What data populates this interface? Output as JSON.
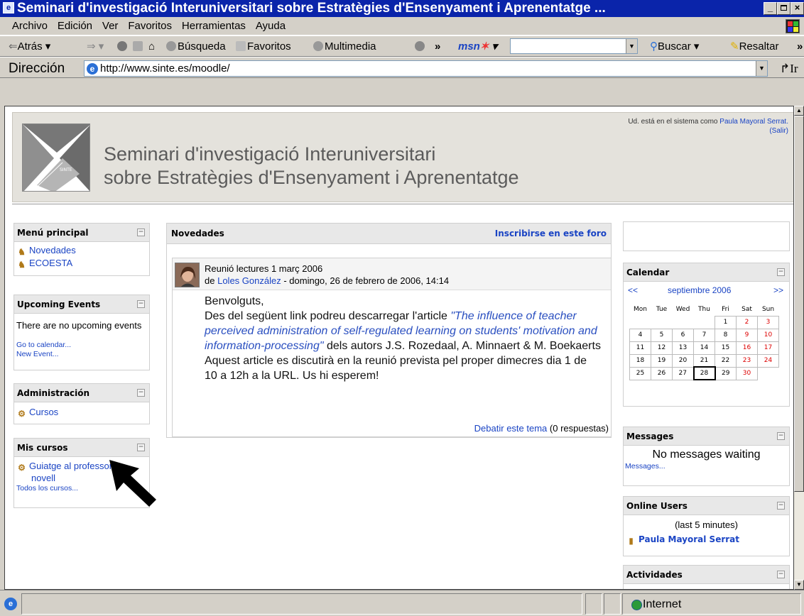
{
  "window": {
    "title": "Seminari d'investigació Interuniversitari sobre Estratègies d'Ensenyament i Aprenentatge ...",
    "minimize": "_",
    "maximize": "▫",
    "close": "×"
  },
  "menubar": {
    "items": [
      "Archivo",
      "Edición",
      "Ver",
      "Favoritos",
      "Herramientas",
      "Ayuda"
    ]
  },
  "toolbar": {
    "back": "Atrás",
    "search": "Búsqueda",
    "favorites": "Favoritos",
    "media": "Multimedia",
    "more": "»",
    "msn": "msn",
    "buscar": "Buscar",
    "resaltar": "Resaltar"
  },
  "addressbar": {
    "label": "Dirección",
    "url": "http://www.sinte.es/moodle/",
    "go": "Ir"
  },
  "status": {
    "zone": "Internet"
  },
  "page": {
    "site_title_line1": "Seminari d'investigació Interuniversitari",
    "site_title_line2": "sobre Estratègies d'Ensenyament i Aprenentatge",
    "logo_text": "SINTE",
    "login_prefix": "Ud. está en el sistema como",
    "login_user": "Paula Mayoral Serrat.",
    "logout": "(Salir)"
  },
  "menu_principal": {
    "title": "Menú principal",
    "items": [
      "Novedades",
      "ECOESTA"
    ]
  },
  "upcoming": {
    "title": "Upcoming Events",
    "empty": "There are no upcoming events",
    "goto": "Go to calendar...",
    "new": "New Event..."
  },
  "admin": {
    "title": "Administración",
    "items": [
      "Cursos"
    ]
  },
  "mis_cursos": {
    "title": "Mis cursos",
    "course_line1": "Guiatge al professor",
    "course_line2": "novell",
    "all": "Todos los cursos..."
  },
  "forum": {
    "title": "Novedades",
    "subscribe": "Inscribirse en este foro",
    "post": {
      "subject": "Reunió lectures 1 març 2006",
      "by": "de",
      "author": "Loles González",
      "date": "- domingo, 26 de febrero de 2006, 14:14",
      "greeting": "Benvolguts,",
      "body_pre": "Des del següent link podreu descarregar l'article",
      "article": "\"The influence of teacher perceived administration of self-regulated learning on students' motivation and information-processing\"",
      "body_post": "dels autors J.S. Rozedaal, A. Minnaert & M. Boekaerts",
      "body2": "Aquest article es discutirà en la reunió prevista pel proper dimecres dia 1 de 10 a 12h a la URL. Us hi esperem!",
      "discuss": "Debatir este tema",
      "replies": "(0 respuestas)"
    }
  },
  "calendar": {
    "title": "Calendar",
    "prev": "<<",
    "month": "septiembre 2006",
    "next": ">>",
    "weekdays": [
      "Mon",
      "Tue",
      "Wed",
      "Thu",
      "Fri",
      "Sat",
      "Sun"
    ],
    "weeks": [
      [
        "",
        "",
        "",
        "",
        "1",
        "2",
        "3"
      ],
      [
        "4",
        "5",
        "6",
        "7",
        "8",
        "9",
        "10"
      ],
      [
        "11",
        "12",
        "13",
        "14",
        "15",
        "16",
        "17"
      ],
      [
        "18",
        "19",
        "20",
        "21",
        "22",
        "23",
        "24"
      ],
      [
        "25",
        "26",
        "27",
        "28",
        "29",
        "30",
        ""
      ]
    ],
    "today": "28"
  },
  "messages": {
    "title": "Messages",
    "empty": "No messages waiting",
    "link": "Messages..."
  },
  "online": {
    "title": "Online Users",
    "period": "(last 5 minutes)",
    "user": "Paula Mayoral Serrat"
  },
  "activities": {
    "title": "Actividades"
  },
  "colors": {
    "titlebar": "#0a24aa",
    "link": "#1a44c4",
    "weekend": "#dd0000"
  }
}
